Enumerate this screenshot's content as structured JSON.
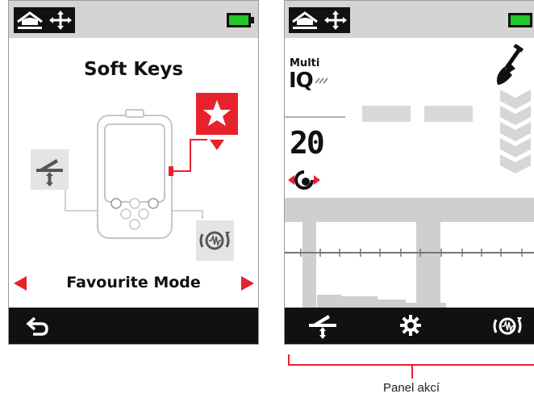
{
  "left_screen": {
    "title": "Soft Keys",
    "mode_label": "Favourite Mode",
    "icons": {
      "top_left": "home-icon",
      "top_move": "move-arrows-icon",
      "battery": "battery-icon",
      "back": "back-arrow-icon",
      "star": "star-icon",
      "ground_balance": "ground-balance-icon",
      "noise_cancel": "noise-cancel-icon"
    }
  },
  "right_screen": {
    "mode_name_line1": "Multi",
    "mode_name_line2": "IQ",
    "sensitivity": "20",
    "icons": {
      "top_left": "home-icon",
      "top_move": "move-arrows-icon",
      "battery": "battery-icon",
      "digger": "digger-icon",
      "depth_chevrons": "depth-chevrons-icon",
      "ground_balance": "ground-balance-icon",
      "settings": "gear-icon",
      "noise_cancel": "noise-cancel-icon"
    }
  },
  "caption": "Panel akcí",
  "colors": {
    "accent_red": "#e8222c",
    "battery_green": "#22c728",
    "bar_gray": "#d4d4d4",
    "bottom_bar": "#111111"
  }
}
